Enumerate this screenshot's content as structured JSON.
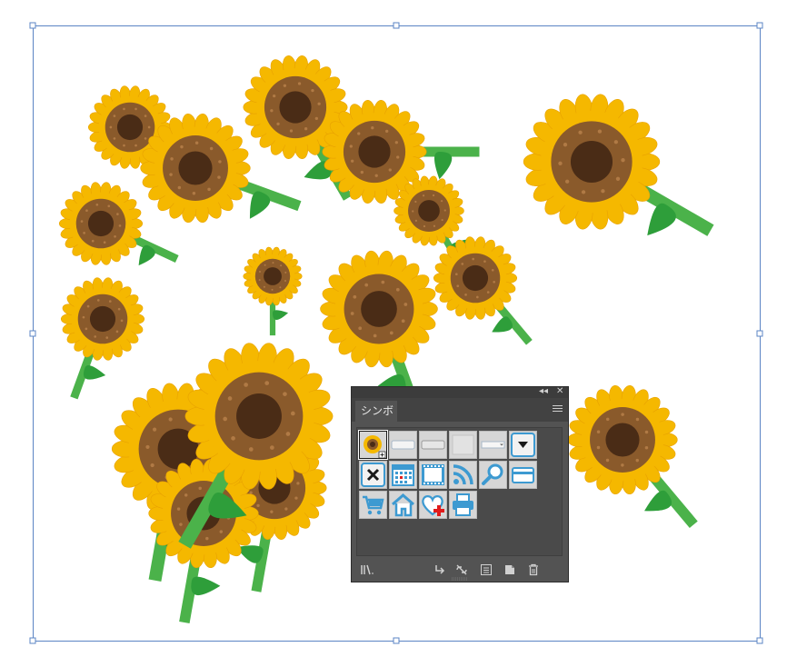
{
  "panel": {
    "tab_label": "シンボル",
    "collapse_glyph": "◂◂",
    "close_glyph": "✕",
    "menu_icon": "hamburger-menu-icon"
  },
  "symbols": [
    {
      "name": "sunflower-symbol",
      "icon": "sunflower-icon",
      "selected": true
    },
    {
      "name": "blank-button-symbol",
      "icon": "light-button-icon"
    },
    {
      "name": "gray-button-symbol",
      "icon": "gray-button-icon"
    },
    {
      "name": "blank-square-symbol",
      "icon": "blank-square-icon"
    },
    {
      "name": "dropdown-field-symbol",
      "icon": "dropdown-field-icon"
    },
    {
      "name": "dropdown-arrow-symbol",
      "icon": "triangle-down-icon"
    },
    {
      "name": "close-x-symbol",
      "icon": "x-icon"
    },
    {
      "name": "calendar-symbol",
      "icon": "calendar-icon"
    },
    {
      "name": "film-frame-symbol",
      "icon": "film-icon"
    },
    {
      "name": "rss-feed-symbol",
      "icon": "rss-icon"
    },
    {
      "name": "magnifier-symbol",
      "icon": "search-icon"
    },
    {
      "name": "credit-card-symbol",
      "icon": "card-icon"
    },
    {
      "name": "shopping-cart-symbol",
      "icon": "cart-icon"
    },
    {
      "name": "home-symbol",
      "icon": "home-icon"
    },
    {
      "name": "heart-plus-symbol",
      "icon": "heart-plus-icon"
    },
    {
      "name": "printer-symbol",
      "icon": "printer-icon"
    }
  ],
  "bottom_bar": [
    {
      "name": "symbol-library-menu-button",
      "icon": "library-icon"
    },
    {
      "name": "place-symbol-instance-button",
      "icon": "place-arrow-icon"
    },
    {
      "name": "break-link-button",
      "icon": "broken-link-icon"
    },
    {
      "name": "symbol-options-button",
      "icon": "options-icon"
    },
    {
      "name": "new-symbol-button",
      "icon": "new-symbol-icon"
    },
    {
      "name": "delete-symbol-button",
      "icon": "trash-icon"
    }
  ],
  "colors": {
    "petal": "#f5b800",
    "petal_edge": "#e8a200",
    "disk_outer": "#8a5a2b",
    "disk_inner": "#4a2c16",
    "leaf": "#2e9e3a",
    "stem": "#4bb24a",
    "bbox": "#5b84c4",
    "panel_bg": "#535353",
    "icon_blue": "#3d9ad1"
  }
}
